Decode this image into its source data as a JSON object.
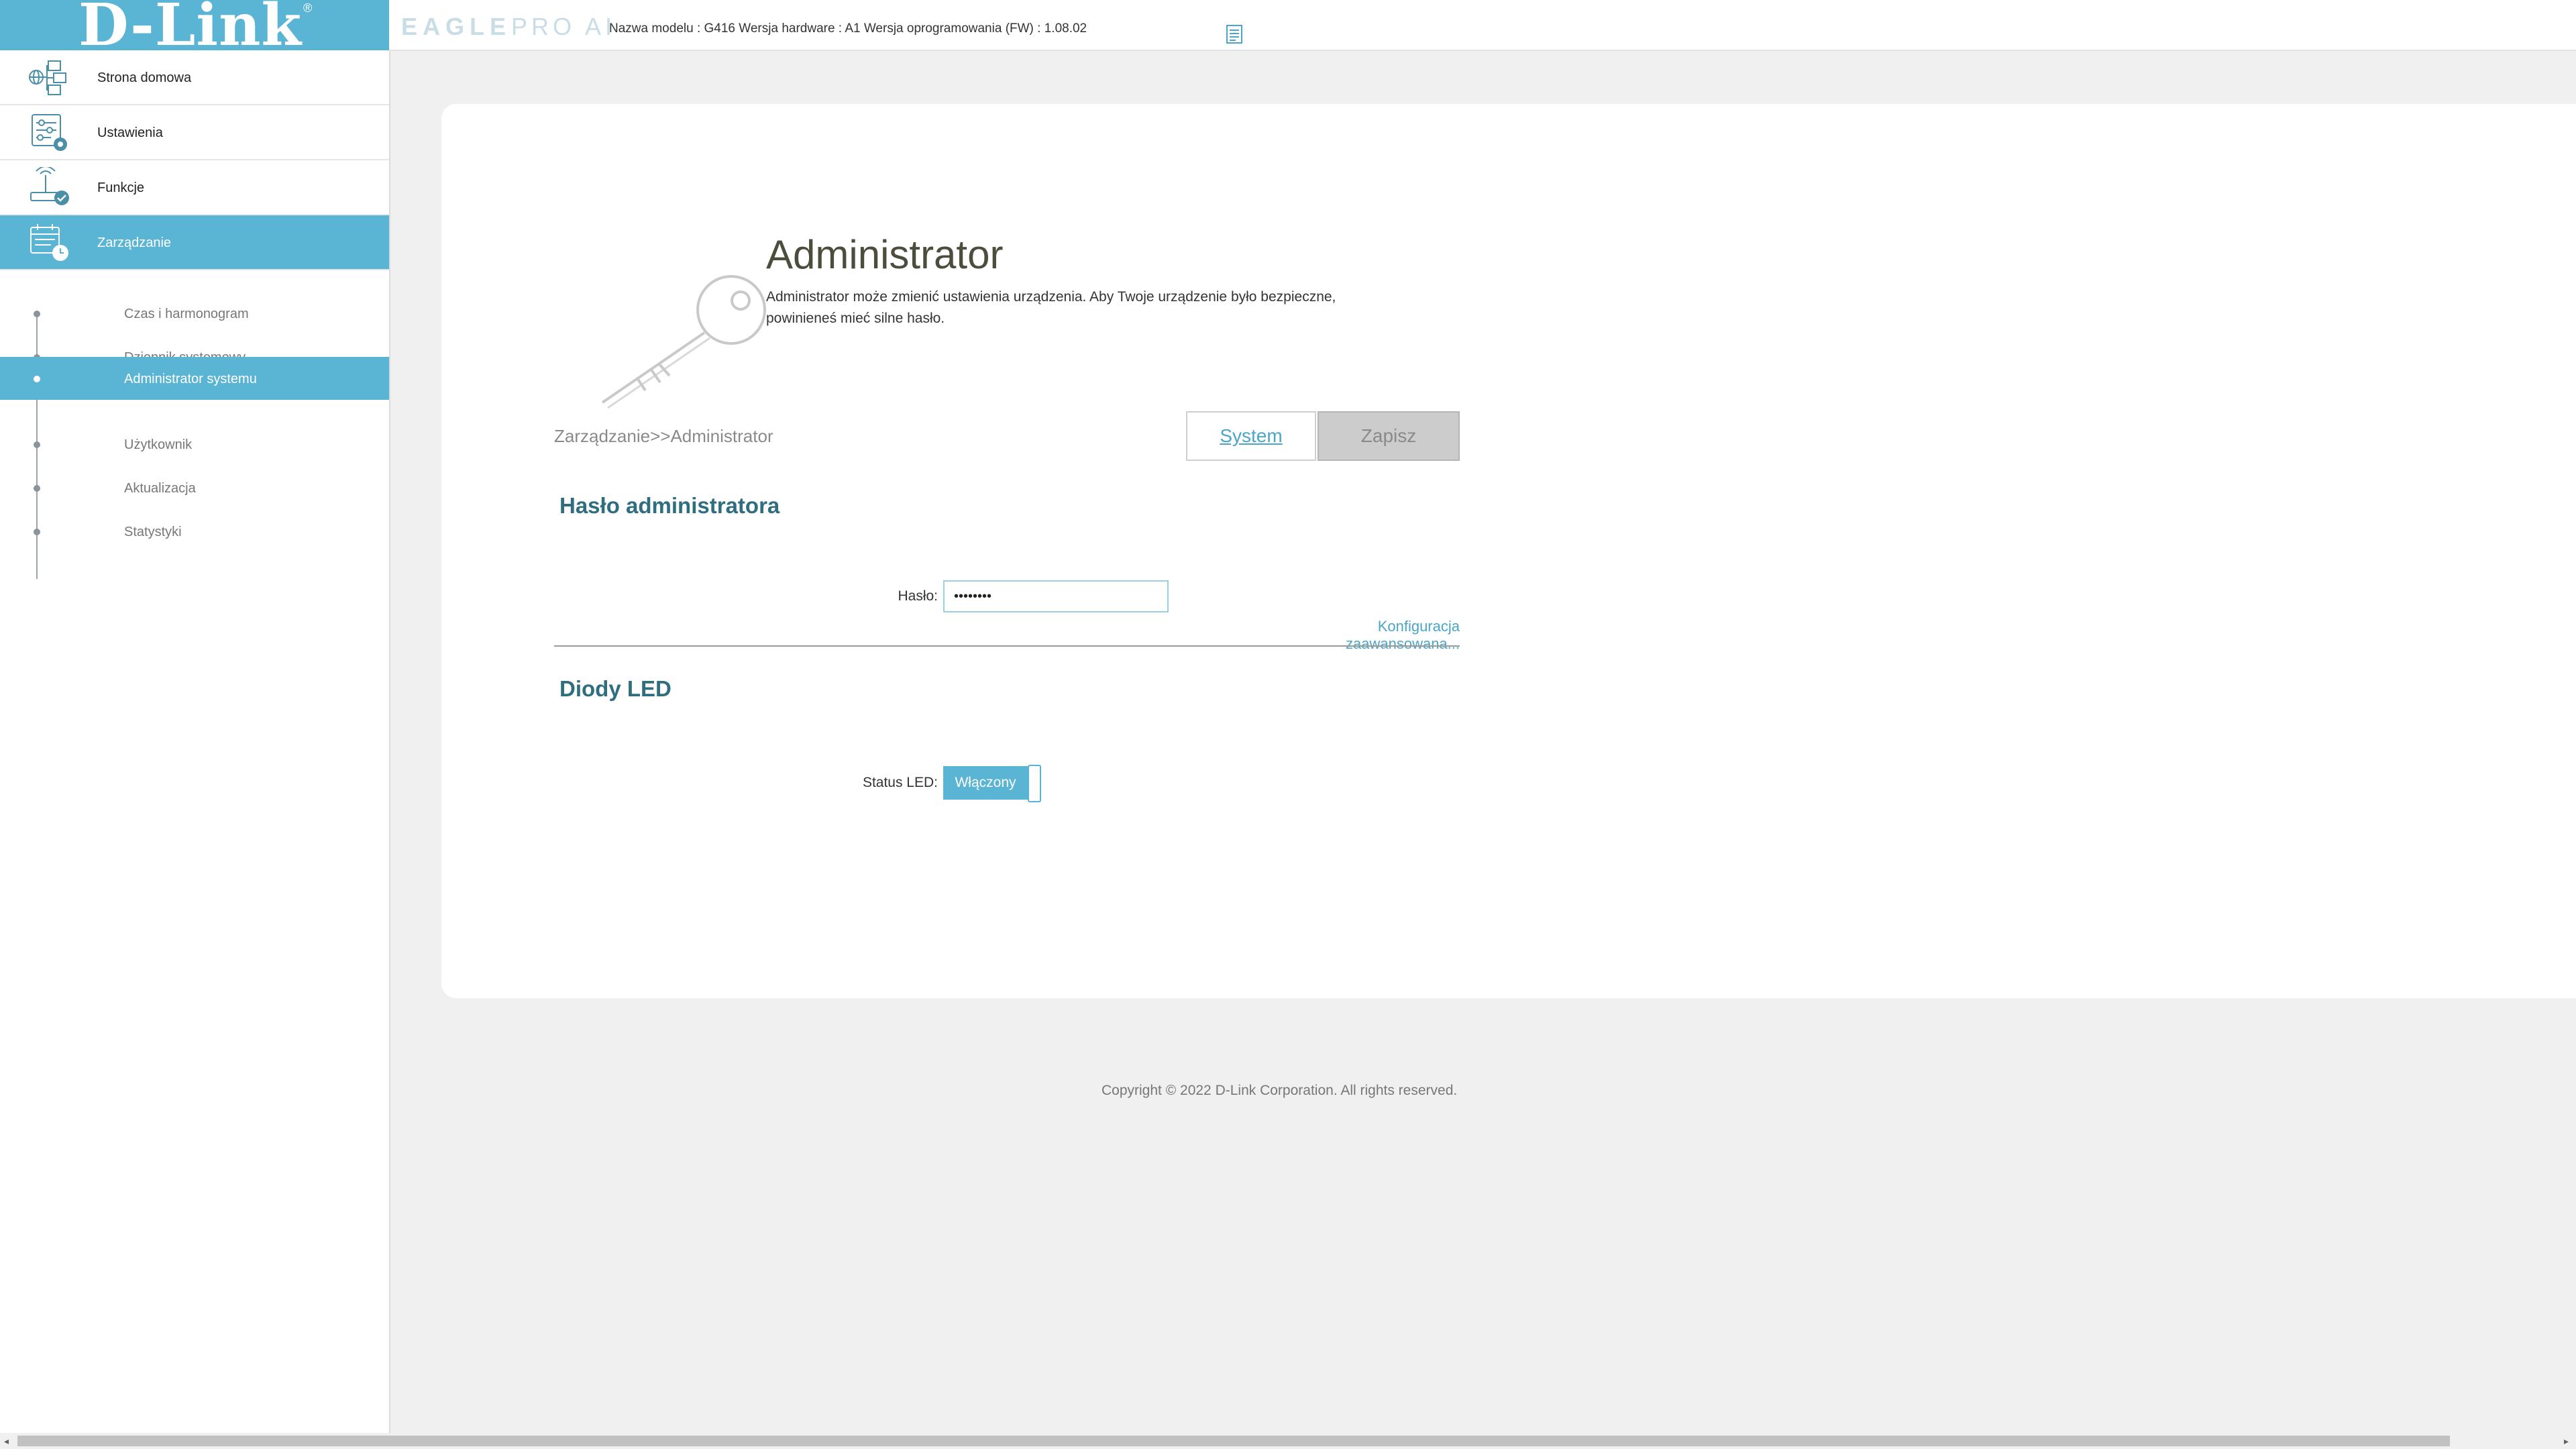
{
  "brand": {
    "logo_text": "D-Link",
    "registered_mark": "®",
    "product_bold": "EAGLE",
    "product_light": "PRO AI"
  },
  "header": {
    "model_info": "Nazwa modelu : G416 Wersja hardware : A1 Wersja oprogramowania (FW) : 1.08.02",
    "notes_icon": "document-icon"
  },
  "sidebar": {
    "items": [
      {
        "label": "Strona domowa",
        "icon": "home-network-icon"
      },
      {
        "label": "Ustawienia",
        "icon": "settings-sliders-icon"
      },
      {
        "label": "Funkcje",
        "icon": "router-check-icon"
      },
      {
        "label": "Zarządzanie",
        "icon": "calendar-clock-icon",
        "active": true
      }
    ],
    "subitems": [
      {
        "label": "Czas i harmonogram"
      },
      {
        "label": "Dziennik systemowy"
      },
      {
        "label": "Administrator systemu",
        "active": true
      },
      {
        "label": "Użytkownik"
      },
      {
        "label": "Aktualizacja"
      },
      {
        "label": "Statystyki"
      }
    ]
  },
  "main": {
    "title": "Administrator",
    "description": "Administrator może zmienić ustawienia urządzenia. Aby Twoje urządzenie było bezpieczne, powinieneś mieć silne hasło.",
    "breadcrumb": "Zarządzanie>>Administrator",
    "system_button": "System",
    "save_button": "Zapisz",
    "password_section": {
      "title": "Hasło administratora",
      "label": "Hasło:",
      "value": "••••••••",
      "advanced_link": "Konfiguracja zaawansowana..."
    },
    "led_section": {
      "title": "Diody LED",
      "label": "Status LED:",
      "toggle_value": "Włączony"
    }
  },
  "footer": {
    "copyright": "Copyright © 2022 D-Link Corporation. All rights reserved."
  },
  "colors": {
    "accent": "#5ab4d4",
    "section_title": "#2f6e7e",
    "link": "#4aa6c8"
  }
}
